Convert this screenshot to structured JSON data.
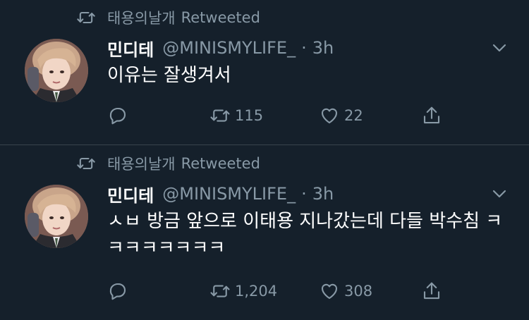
{
  "colors": {
    "background": "#15202b",
    "divider": "#38444d",
    "secondary_text": "#8899a6",
    "primary_text": "#ffffff"
  },
  "tweets": [
    {
      "retweeted_by": "태용의날개",
      "retweeted_label": "Retweeted",
      "display_name": "민디테",
      "handle": "@MINISMYLIFE_",
      "separator": "·",
      "time": "3h",
      "text": "이유는 잘생겨서",
      "retweet_count": "115",
      "like_count": "22"
    },
    {
      "retweeted_by": "태용의날개",
      "retweeted_label": "Retweeted",
      "display_name": "민디테",
      "handle": "@MINISMYLIFE_",
      "separator": "·",
      "time": "3h",
      "text": "ㅅㅂ 방금 앞으로 이태용 지나갔는데 다들 박수침 ㅋㅋㅋㅋㅋㅋㅋㅋ",
      "retweet_count": "1,204",
      "like_count": "308"
    }
  ],
  "icons": [
    "retweet-icon",
    "reply-icon",
    "like-icon",
    "share-icon",
    "chevron-down-icon"
  ]
}
